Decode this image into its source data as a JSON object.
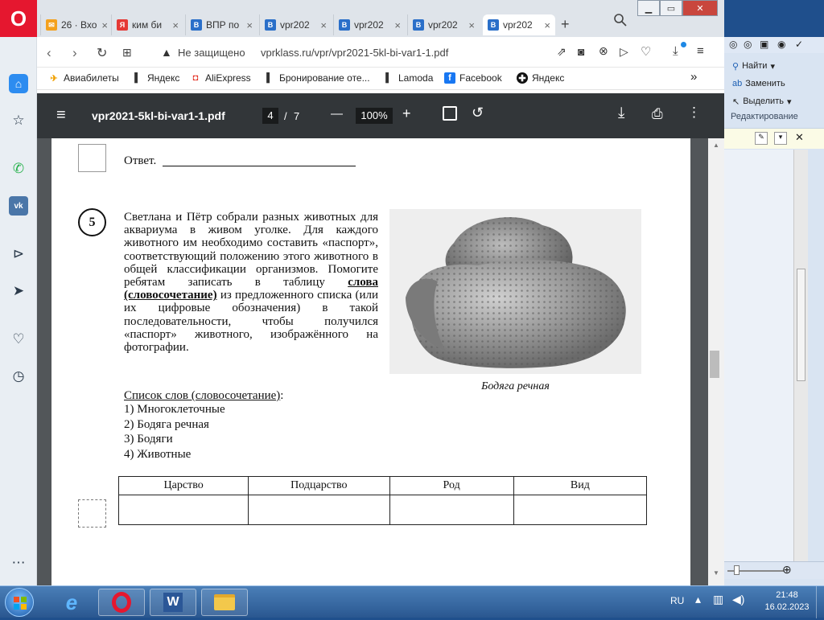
{
  "browser": {
    "logo": "O",
    "tabs": [
      {
        "label": "26 · Вхо",
        "fav_color": "#f4a11d",
        "fav": "✉"
      },
      {
        "label": "ким би",
        "fav_color": "#e53935",
        "fav": "Я"
      },
      {
        "label": "ВПР по",
        "fav_color": "#2a6fc9",
        "fav": "В"
      },
      {
        "label": "vpr202",
        "fav_color": "#2a6fc9",
        "fav": "В"
      },
      {
        "label": "vpr202",
        "fav_color": "#2a6fc9",
        "fav": "В"
      },
      {
        "label": "vpr202",
        "fav_color": "#2a6fc9",
        "fav": "В"
      },
      {
        "label": "vpr202",
        "fav_color": "#2a6fc9",
        "fav": "В"
      }
    ],
    "new_tab": "+",
    "security_label": "Не защищено",
    "url": "vprklass.ru/vpr/vpr2021-5kl-bi-var1-1.pdf",
    "bookmarks": [
      {
        "label": "Авиабилеты",
        "icon": "plane-icon"
      },
      {
        "label": "Яндекс",
        "icon": "bookmark-icon"
      },
      {
        "label": "AliExpress",
        "icon": "aliexpress-icon"
      },
      {
        "label": "Бронирование оте...",
        "icon": "bookmark-icon"
      },
      {
        "label": "Lamoda",
        "icon": "bookmark-icon"
      },
      {
        "label": "Facebook",
        "icon": "facebook-icon"
      },
      {
        "label": "Яндекс",
        "icon": "yandex-icon"
      }
    ],
    "bookmarks_more": "»"
  },
  "pdf": {
    "filename": "vpr2021-5kl-bi-var1-1.pdf",
    "page_current": "4",
    "page_sep": "/",
    "page_total": "7",
    "zoom": "100%",
    "zoom_minus": "—",
    "zoom_plus": "+"
  },
  "document": {
    "answer_label": "Ответ.",
    "task_number": "5",
    "task_text_1": "Светлана и Пётр собрали разных животных для аквариума в живом уголке. Для каждого животного им необходимо составить «паспорт», соответствующий положению этого животного в общей классификации организмов. Помогите ребятам записать в таблицу",
    "task_text_bold": "слова (словосочетание)",
    "task_text_2": "из предложенного списка (или их цифровые обозначения) в такой последовательности, чтобы получился «паспорт» животного, изображённого на фотографии.",
    "photo_caption": "Бодяга речная",
    "list_title": "Список слов (словосочетание)",
    "list_colon": ":",
    "list": [
      "1) Многоклеточные",
      "2) Бодяга речная",
      "3) Бодяги",
      "4) Животные"
    ],
    "table_headers": [
      "Царство",
      "Подцарство",
      "Род",
      "Вид"
    ]
  },
  "word": {
    "find": "Найти",
    "replace": "Заменить",
    "select": "Выделить",
    "group": "Редактирование"
  },
  "taskbar": {
    "lang": "RU",
    "time": "21:48",
    "date": "16.02.2023"
  }
}
